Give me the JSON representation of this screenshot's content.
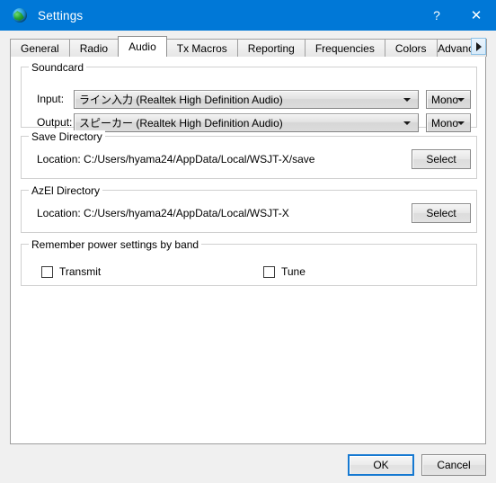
{
  "window": {
    "title": "Settings",
    "icon": "globe-icon",
    "accent_color": "#0078d7",
    "help_label": "?",
    "close_label": "✕"
  },
  "tabs": [
    {
      "label": "General",
      "selected": false
    },
    {
      "label": "Radio",
      "selected": false
    },
    {
      "label": "Audio",
      "selected": true
    },
    {
      "label": "Tx Macros",
      "selected": false
    },
    {
      "label": "Reporting",
      "selected": false
    },
    {
      "label": "Frequencies",
      "selected": false
    },
    {
      "label": "Colors",
      "selected": false
    },
    {
      "label": "Advanced",
      "selected": false
    }
  ],
  "tab_scroll": {
    "right_arrow": "▶"
  },
  "soundcard": {
    "legend": "Soundcard",
    "input_label": "Input:",
    "input_value": "ライン入力 (Realtek High Definition Audio)",
    "input_channel": "Mono",
    "output_label": "Output:",
    "output_value": "スピーカー (Realtek High Definition Audio)",
    "output_channel": "Mono"
  },
  "save_directory": {
    "legend": "Save Directory",
    "location": "Location: C:/Users/hyama24/AppData/Local/WSJT-X/save",
    "select_label": "Select"
  },
  "azel_directory": {
    "legend": "AzEl Directory",
    "location": "Location: C:/Users/hyama24/AppData/Local/WSJT-X",
    "select_label": "Select"
  },
  "power_settings": {
    "legend": "Remember power settings by band",
    "transmit_label": "Transmit",
    "transmit_checked": false,
    "tune_label": "Tune",
    "tune_checked": false
  },
  "footer": {
    "ok_label": "OK",
    "cancel_label": "Cancel"
  }
}
